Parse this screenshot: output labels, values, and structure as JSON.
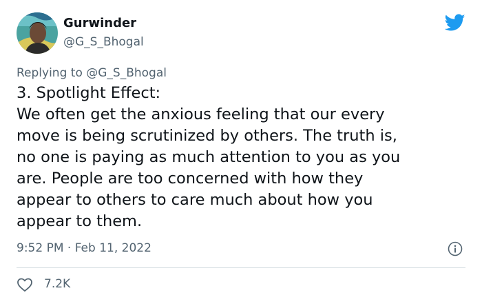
{
  "author": {
    "display_name": "Gurwinder",
    "handle": "@G_S_Bhogal",
    "avatar_icon": "user-avatar"
  },
  "platform_icon": "twitter-bird-icon",
  "brand_color": "#1d9bf0",
  "replying_to": "Replying to @G_S_Bhogal",
  "tweet": {
    "text": "3. Spotlight Effect:\nWe often get the anxious feeling that our every\nmove is being scrutinized by others. The truth is,\nno one is paying as much attention to you as you\nare. People are too concerned with how they\nappear to others to care much about how you\nappear to them.",
    "timestamp": "9:52 PM · Feb 11, 2022"
  },
  "engagement": {
    "like_icon": "heart-icon",
    "like_count": "7.2K",
    "info_icon": "info-icon"
  }
}
